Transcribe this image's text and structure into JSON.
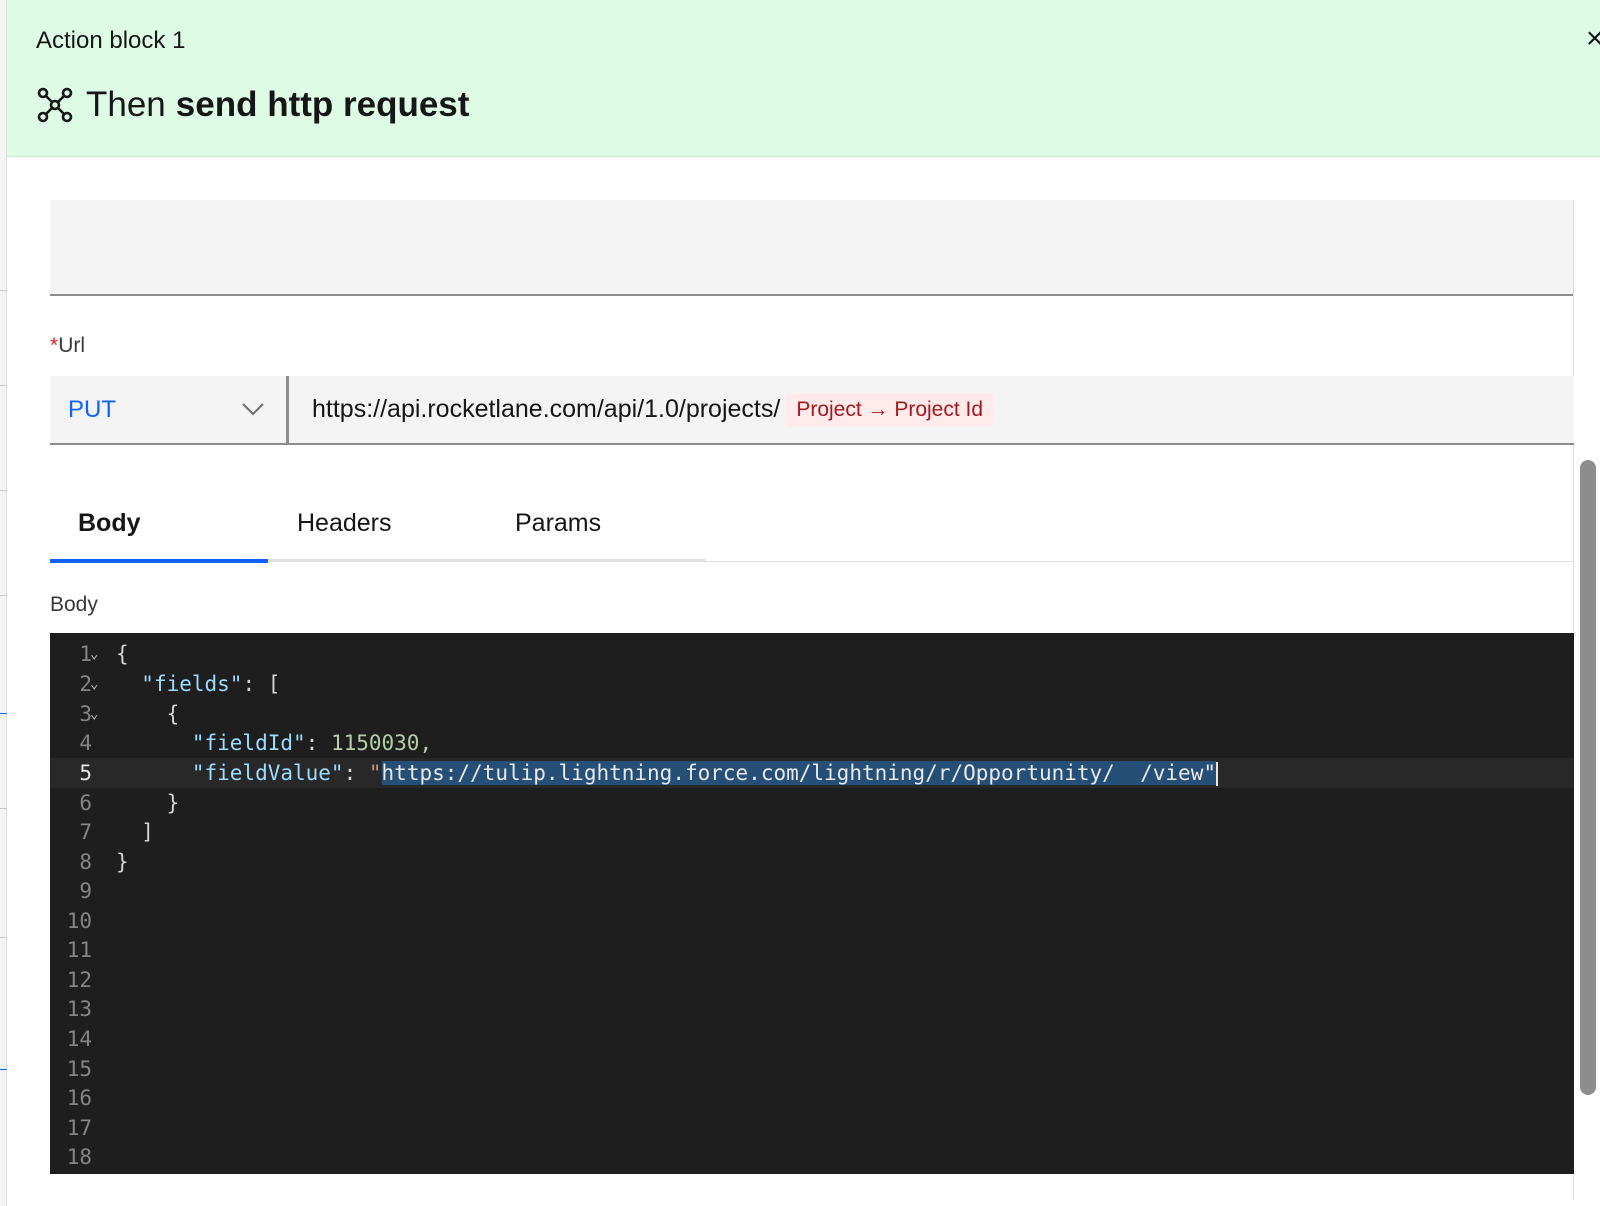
{
  "header": {
    "block_label": "Action block 1",
    "close_glyph": "×",
    "title_prefix": "Then",
    "title_main": "send http request",
    "icon": "webhook-icon",
    "bg_color": "#defbe6"
  },
  "url": {
    "label": "Url",
    "required_marker": "*",
    "method": "PUT",
    "value": "https://api.rocketlane.com/api/1.0/projects/",
    "variable_chip": "Project → Project Id"
  },
  "tabs": [
    {
      "label": "Body",
      "active": true
    },
    {
      "label": "Headers",
      "active": false
    },
    {
      "label": "Params",
      "active": false
    }
  ],
  "body": {
    "label": "Body",
    "current_line": 5,
    "line_numbers": [
      "1",
      "2",
      "3",
      "4",
      "5",
      "6",
      "7",
      "8",
      "9",
      "10",
      "11",
      "12",
      "13",
      "14",
      "15",
      "16",
      "17",
      "18"
    ],
    "code": {
      "l1": "{",
      "l2_key": "\"fields\"",
      "l2_rest": ": [",
      "l3": "    {",
      "l4_key": "\"fieldId\"",
      "l4_colon": ": ",
      "l4_num": "1150030,",
      "l5_key": "\"fieldValue\"",
      "l5_colon": ": ",
      "l5_open_quote": "\"",
      "l5_selected": "https://tulip.lightning.force.com/lightning/r/Opportunity/  /view\"",
      "l6": "    }",
      "l7": "  ]",
      "l8": "}"
    }
  },
  "colors": {
    "accent": "#0f62fe",
    "chip_bg": "#ffeaec",
    "chip_text": "#a2191f",
    "editor_bg": "#1e1e1e"
  }
}
